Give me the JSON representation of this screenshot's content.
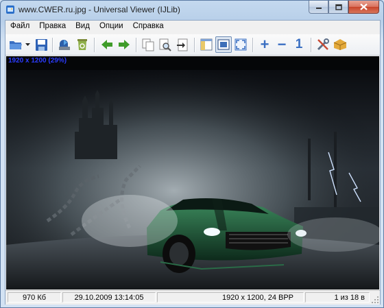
{
  "window": {
    "title": "www.CWER.ru.jpg - Universal Viewer (IJLib)"
  },
  "menu": [
    "Файл",
    "Правка",
    "Вид",
    "Опции",
    "Справка"
  ],
  "toolbar": {
    "icons": [
      "open-folder-icon",
      "dropdown-arrow-icon",
      "save-disk-icon",
      "export-icon",
      "recycle-bin-icon",
      "arrow-left-icon",
      "arrow-right-icon",
      "copy-pages-icon",
      "search-page-icon",
      "goto-page-icon",
      "panel-toggle-icon",
      "fit-window-icon",
      "fullscreen-icon",
      "zoom-in-icon",
      "zoom-out-icon",
      "original-size-icon",
      "tools-icon",
      "package-icon"
    ],
    "zoom_out_sign": "−",
    "zoom_in_sign": "+",
    "original_size_label": "1"
  },
  "viewer": {
    "image_info": "1920 x 1200 (29%)"
  },
  "status": {
    "filesize": "970 Кб",
    "datetime": "29.10.2009 13:14:05",
    "dimensions": "1920 x 1200, 24 BPP",
    "position": "1 из 18 в"
  },
  "colors": {
    "accent": "#2c3cff",
    "car": "#1f5a3a",
    "close_button": "#c8442a"
  }
}
